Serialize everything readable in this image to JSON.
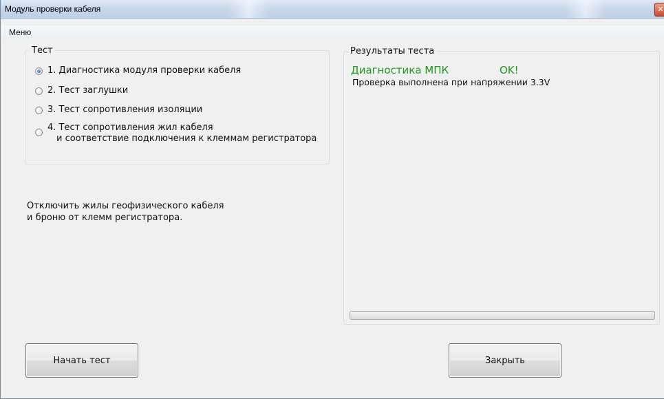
{
  "window": {
    "title": "Модуль проверки кабеля",
    "close_symbol": "✕"
  },
  "menu": {
    "items": [
      {
        "label": "Меню"
      }
    ]
  },
  "test_group": {
    "legend": "Тест",
    "options": [
      {
        "label": "1. Диагностика модуля проверки кабеля",
        "selected": true
      },
      {
        "label": "2. Тест заглушки",
        "selected": false
      },
      {
        "label": "3. Тест сопротивления изоляции",
        "selected": false
      },
      {
        "label_line1": "4. Тест сопротивления жил кабеля",
        "label_line2": "и соответствие подключения к клеммам регистратора",
        "selected": false
      }
    ]
  },
  "instruction": {
    "line1": "Отключить жилы геофизического кабеля",
    "line2": "и броню от клемм регистратора."
  },
  "results": {
    "legend": "Результаты теста",
    "test_name": "Диагностика МПК",
    "status": "OK!",
    "note": "Проверка выполнена при напряжении 3.3V",
    "status_color": "#1e9a1e",
    "progress_percent": 0
  },
  "buttons": {
    "start": "Начать тест",
    "close": "Закрыть"
  },
  "colors": {
    "ok_text": "#1e9a1e",
    "window_bg": "#f0f0f0",
    "titlebar": "#c9d8ea"
  }
}
